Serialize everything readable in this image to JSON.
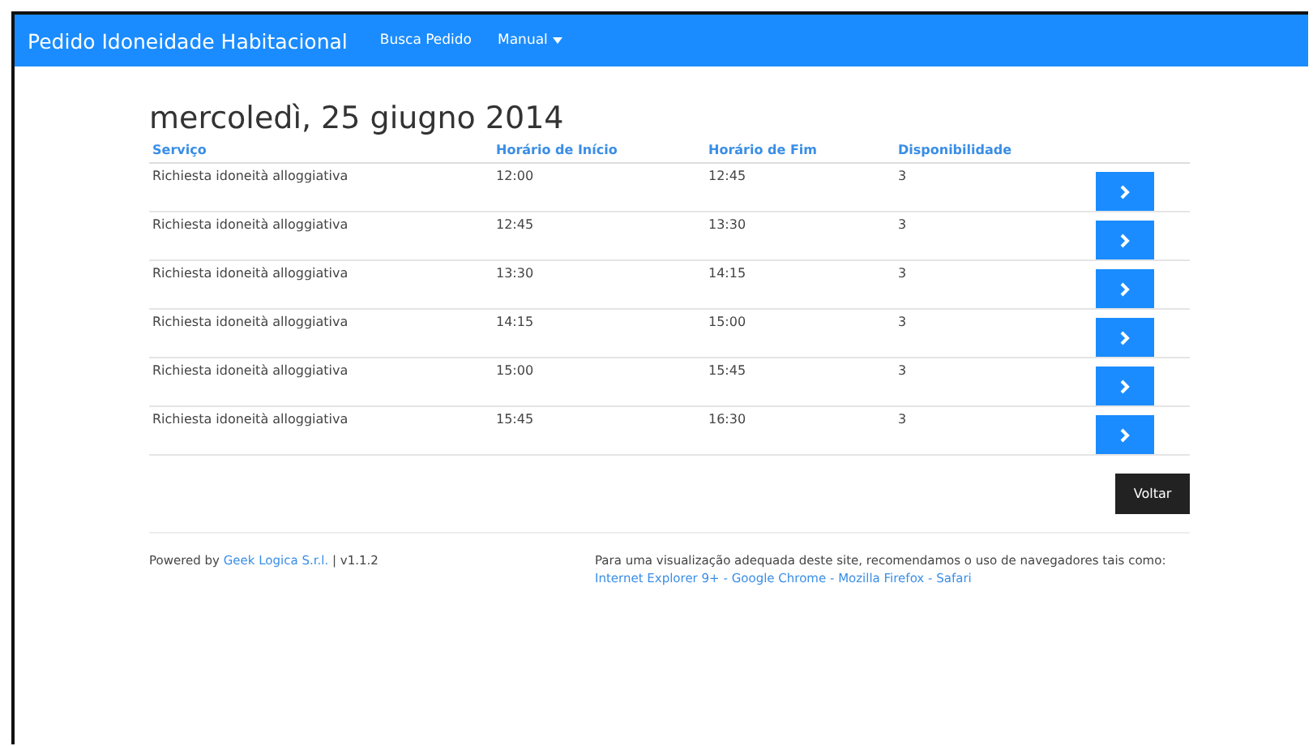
{
  "navbar": {
    "brand": "Pedido Idoneidade Habitacional",
    "links": [
      {
        "label": "Busca Pedido",
        "kind": "link"
      },
      {
        "label": "Manual",
        "kind": "dropdown"
      }
    ]
  },
  "heading": "mercoledì, 25 giugno 2014",
  "table": {
    "columns": [
      "Serviço",
      "Horário de Início",
      "Horário de Fim",
      "Disponibilidade"
    ],
    "rows": [
      {
        "cells": [
          "Richiesta idoneità alloggiativa",
          "12:00",
          "12:45",
          "3"
        ]
      },
      {
        "cells": [
          "Richiesta idoneità alloggiativa",
          "12:45",
          "13:30",
          "3"
        ]
      },
      {
        "cells": [
          "Richiesta idoneità alloggiativa",
          "13:30",
          "14:15",
          "3"
        ]
      },
      {
        "cells": [
          "Richiesta idoneità alloggiativa",
          "14:15",
          "15:00",
          "3"
        ]
      },
      {
        "cells": [
          "Richiesta idoneità alloggiativa",
          "15:00",
          "15:45",
          "3"
        ]
      },
      {
        "cells": [
          "Richiesta idoneità alloggiativa",
          "15:45",
          "16:30",
          "3"
        ]
      }
    ]
  },
  "back_button": "Voltar",
  "footer": {
    "powered_prefix": "Powered by ",
    "company_link": "Geek Logica S.r.l.",
    "version": " | v1.1.2",
    "recommendation": "Para uma visualização adequada deste site, recomendamos o uso de navegadores tais como:",
    "browsers": [
      "Internet Explorer 9+",
      "Google Chrome",
      "Mozilla Firefox",
      "Safari"
    ],
    "separator": " - "
  }
}
